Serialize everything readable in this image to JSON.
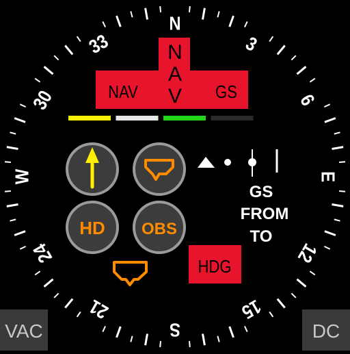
{
  "compass": {
    "heading_labels": [
      {
        "deg": 0,
        "text": "N"
      },
      {
        "deg": 30,
        "text": "3"
      },
      {
        "deg": 60,
        "text": "6"
      },
      {
        "deg": 90,
        "text": "E"
      },
      {
        "deg": 120,
        "text": "12"
      },
      {
        "deg": 150,
        "text": "15"
      },
      {
        "deg": 180,
        "text": "S"
      },
      {
        "deg": 210,
        "text": "21"
      },
      {
        "deg": 240,
        "text": "24"
      },
      {
        "deg": 270,
        "text": "W"
      },
      {
        "deg": 300,
        "text": "30"
      },
      {
        "deg": 330,
        "text": "33"
      }
    ]
  },
  "flags": {
    "nav_left": "NAV",
    "nav_vertical": "NAV",
    "gs": "GS",
    "hdg": "HDG"
  },
  "indicator_bars": [
    {
      "color": "#f5f000"
    },
    {
      "color": "#e8e8e8"
    },
    {
      "color": "#22d41a"
    },
    {
      "color": "#2a2a2a"
    }
  ],
  "buttons": {
    "hd": "HD",
    "obs": "OBS"
  },
  "nav_status": {
    "gs": "GS",
    "from": "FROM",
    "to": "TO"
  },
  "corners": {
    "left": "VAC",
    "right": "DC"
  },
  "colors": {
    "flag_red": "#e8142c",
    "orange": "#ff8c00",
    "yellow": "#ffef00",
    "button_bg": "#3c3c3c",
    "button_ring": "#9a9a9a"
  }
}
